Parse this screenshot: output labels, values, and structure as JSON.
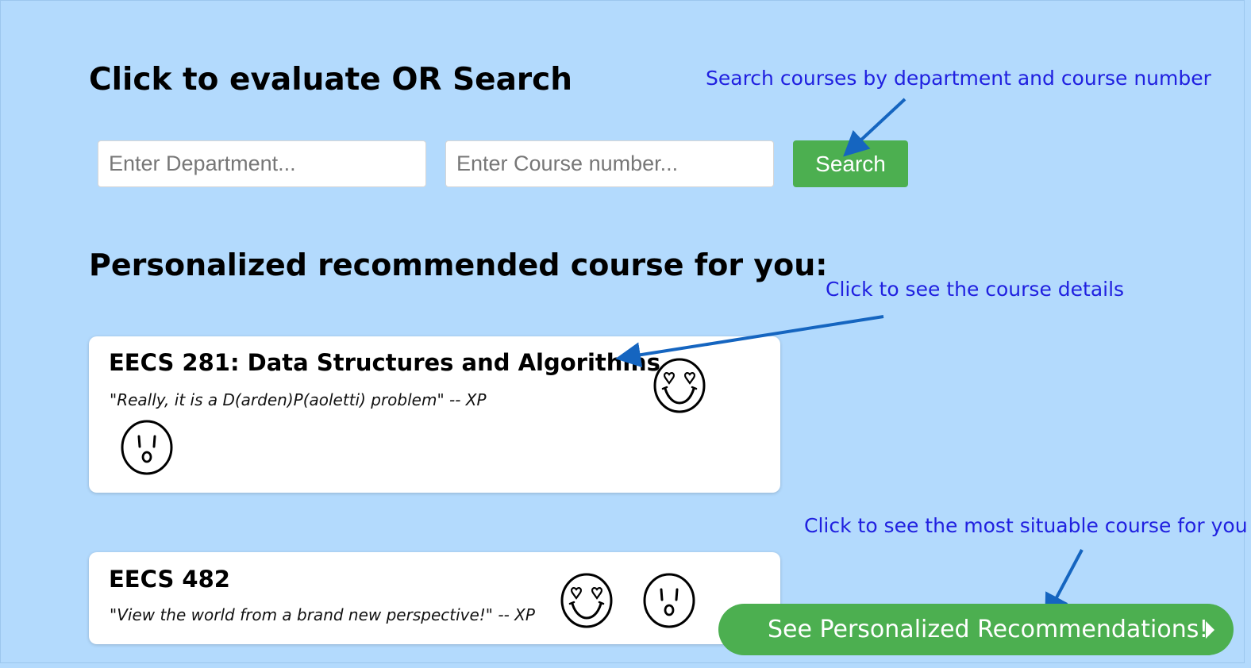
{
  "search_section": {
    "title": "Click to evaluate OR Search",
    "department_placeholder": "Enter Department...",
    "course_number_placeholder": "Enter Course number...",
    "search_label": "Search"
  },
  "recommendations": {
    "title": "Personalized recommended course for you:",
    "courses": [
      {
        "title": "EECS 281: Data Structures and Algorithms",
        "quote": "\"Really, it is a D(arden)P(aoletti) problem\" -- XP",
        "reactions": [
          "heart-eyes-smiley-icon",
          "surprised-face-icon"
        ]
      },
      {
        "title": "EECS 482",
        "quote": "\"View the world from a brand new perspective!\" -- XP",
        "reactions": [
          "heart-eyes-smiley-icon",
          "surprised-face-icon"
        ]
      }
    ],
    "cta_label": "See Personalized Recommendations!"
  },
  "annotations": {
    "search_note": "Search courses by department and course number",
    "details_note": "Click to see the course details",
    "situable_note": "Click to see the most situable course for you"
  },
  "colors": {
    "background": "#b3dafd",
    "accent_green": "#4caf50",
    "annotation_text": "#2020e0",
    "arrow": "#1565c0"
  }
}
